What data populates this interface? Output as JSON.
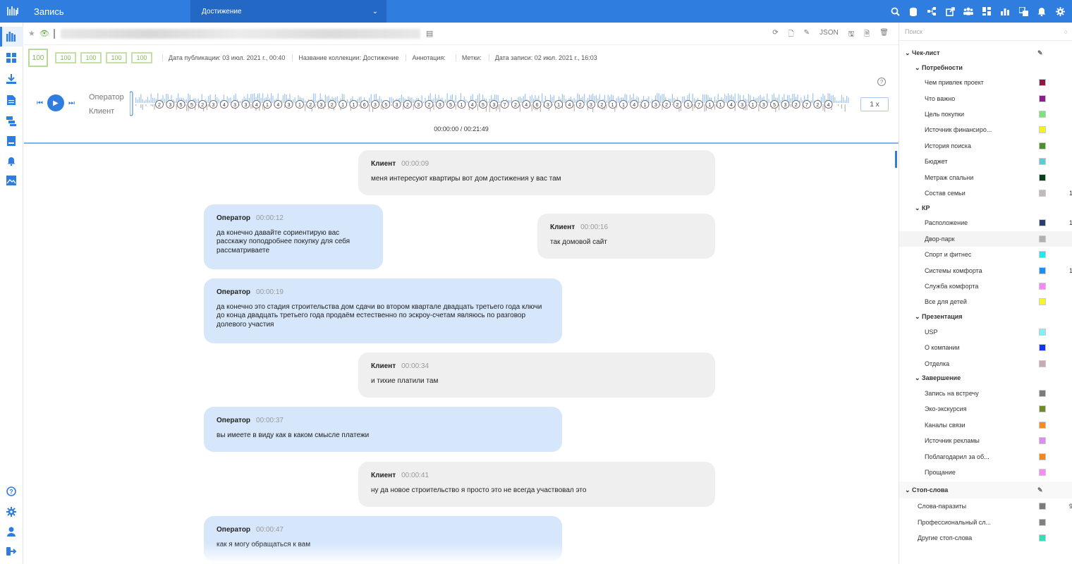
{
  "topbar": {
    "app_title": "Запись",
    "collection": "Достижение",
    "icons": [
      "search-icon",
      "database-icon",
      "network-icon",
      "export-icon",
      "users-icon",
      "dashboard-icon",
      "chart-icon",
      "translate-icon",
      "bell-icon",
      "gear-icon"
    ]
  },
  "leftbar": {
    "top_icons": [
      "library-icon",
      "widgets-icon",
      "download-icon",
      "document-icon",
      "layers-icon",
      "card-icon",
      "notification-icon",
      "image-icon"
    ],
    "bottom_icons": [
      "help-icon",
      "settings-icon",
      "user-icon",
      "logout-icon"
    ]
  },
  "header": {
    "actions": {
      "refresh": "⟳",
      "file": "🗋",
      "edit": "✎",
      "json": "JSON",
      "save": "🖫",
      "pdf": "🗎",
      "delete": "🗑"
    },
    "scores": {
      "main": "100",
      "s1": "100",
      "s2": "100",
      "s3": "100",
      "s4": "100"
    },
    "pub_date": "Дата публикации: 03 июл. 2021 г., 00:40",
    "collection_name": "Название коллекции: Достижение",
    "annotation": "Аннотация:",
    "tags": "Метки:",
    "record_date": "Дата записи: 02 июл. 2021 г., 16:03"
  },
  "player": {
    "operator_label": "Оператор",
    "client_label": "Клиент",
    "speed": "1 x",
    "time": "00:00:00 / 00:21:49",
    "markers": [
      "2",
      "3",
      "5",
      "5",
      "2",
      "3",
      "4",
      "3",
      "3",
      "4",
      "1",
      "4",
      "3",
      "1",
      "2",
      "3",
      "2",
      "1",
      "1",
      "6",
      "3",
      "5",
      "3",
      "2",
      "3",
      "2",
      "3",
      "5",
      "1",
      "4",
      "5",
      "3",
      "7",
      "2",
      "4",
      "6",
      "3",
      "1",
      "4",
      "2",
      "3",
      "2",
      "1",
      "1",
      "4",
      "1",
      "3",
      "2",
      "2",
      "1",
      "7",
      "1",
      "1",
      "4",
      "3",
      "1",
      "3",
      "5",
      "3",
      "2",
      "7",
      "2",
      "4"
    ]
  },
  "chat": [
    {
      "speaker": "Клиент",
      "time": "00:00:09",
      "text": "меня интересуют квартиры вот дом достижения у вас там"
    },
    {
      "speaker": "Оператор",
      "time": "00:00:12",
      "text": "да конечно давайте сориентирую вас расскажу поподробнее покупку для себя рассматриваете"
    },
    {
      "speaker": "Клиент",
      "time": "00:00:16",
      "text": "так домовой сайт"
    },
    {
      "speaker": "Оператор",
      "time": "00:00:19",
      "text": "да конечно это стадия строительства дом сдачи во втором квартале двадцать третьего года ключи до конца двадцать третьего года продаём естественно по эскроу-счетам являюсь по разговор долевого участия"
    },
    {
      "speaker": "Клиент",
      "time": "00:00:34",
      "text": "и тихие платили там"
    },
    {
      "speaker": "Оператор",
      "time": "00:00:37",
      "text": "вы имеете в виду как в каком смысле платежи"
    },
    {
      "speaker": "Клиент",
      "time": "00:00:41",
      "text": "ну да новое строительство я просто это не всегда участвовал это"
    },
    {
      "speaker": "Оператор",
      "time": "00:00:47",
      "text": "как я могу обращаться к вам"
    }
  ],
  "panel": {
    "search_placeholder": "Поиск",
    "checklist_title": "Чек-лист",
    "groups": [
      {
        "title": "Потребности",
        "items": [
          {
            "label": "Чем привлек проект",
            "color": "#8b1a4a"
          },
          {
            "label": "Что важно",
            "color": "#8a1f8a"
          },
          {
            "label": "Цель покупки",
            "color": "#7ce07c"
          },
          {
            "label": "Источник финансиро...",
            "color": "#f2f21e"
          },
          {
            "label": "История поиска",
            "color": "#4f8f2a"
          },
          {
            "label": "Бюджет",
            "color": "#5ecbd1"
          },
          {
            "label": "Метраж спальни",
            "color": "#0c3d1e"
          },
          {
            "label": "Состав семьи",
            "color": "#c2b9b9",
            "count": "1"
          }
        ]
      },
      {
        "title": "КР",
        "items": [
          {
            "label": "Расположение",
            "color": "#2a3d6b",
            "count": "1"
          },
          {
            "label": "Двор-парк",
            "color": "#b1b1b1"
          },
          {
            "label": "Спорт и фитнес",
            "color": "#21e8ee"
          },
          {
            "label": "Системы комфорта",
            "color": "#1e8ff2",
            "count": "1"
          },
          {
            "label": "Служба комфорта",
            "color": "#f588f5"
          },
          {
            "label": "Все для детей",
            "color": "#f5f52c"
          }
        ]
      },
      {
        "title": "Презентация",
        "items": [
          {
            "label": "USP",
            "color": "#7ff2f2"
          },
          {
            "label": "О компании",
            "color": "#1139e6"
          },
          {
            "label": "Отделка",
            "color": "#c9a8b8"
          }
        ]
      },
      {
        "title": "Завершение",
        "items": [
          {
            "label": "Запись на встречу",
            "color": "#7a7a7a"
          },
          {
            "label": "Эко-экскурсия",
            "color": "#6e8a2a"
          },
          {
            "label": "Каналы связи",
            "color": "#f28c1e"
          },
          {
            "label": "Источник рекламы",
            "color": "#d98ef0"
          },
          {
            "label": "Поблагодарил за об...",
            "color": "#f2891e"
          },
          {
            "label": "Прощание",
            "color": "#f58cf0"
          }
        ]
      }
    ],
    "stopwords_title": "Стоп-слова",
    "stopwords": [
      {
        "label": "Слова-паразиты",
        "color": "#7b7b7b",
        "count": "9"
      },
      {
        "label": "Профессиональный сл...",
        "color": "#808080"
      },
      {
        "label": "Другие стоп-слова",
        "color": "#2ee0b8"
      }
    ]
  }
}
